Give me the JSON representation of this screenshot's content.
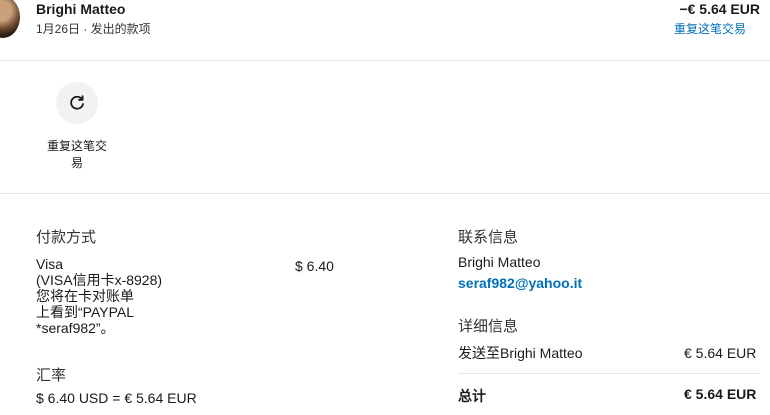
{
  "header": {
    "name": "Brighi Matteo",
    "subline": "1月26日 · 发出的款项",
    "amount": "−€ 5.64 EUR",
    "repeat_link": "重复这笔交易"
  },
  "action": {
    "label": "重复这笔交易",
    "icon": "refresh-icon"
  },
  "payment": {
    "title": "付款方式",
    "detail_lines": [
      "Visa",
      "(VISA信用卡x-8928)",
      "您将在卡对账单",
      "上看到“PAYPAL",
      "*seraf982”。"
    ],
    "amount": "$ 6.40"
  },
  "exchange": {
    "title": "汇率",
    "conversion": "$ 6.40 USD = € 5.64 EUR"
  },
  "contact": {
    "title": "联系信息",
    "name": "Brighi Matteo",
    "email": "seraf982@yahoo.it"
  },
  "details": {
    "title": "详细信息",
    "sent_to_label": "发送至Brighi Matteo",
    "sent_to_amount": "€ 5.64 EUR",
    "total_label": "总计",
    "total_amount": "€ 5.64 EUR"
  },
  "colors": {
    "accent": "#0070ba",
    "divider": "#e9e9e9",
    "button_bg": "#f2f2f2"
  }
}
